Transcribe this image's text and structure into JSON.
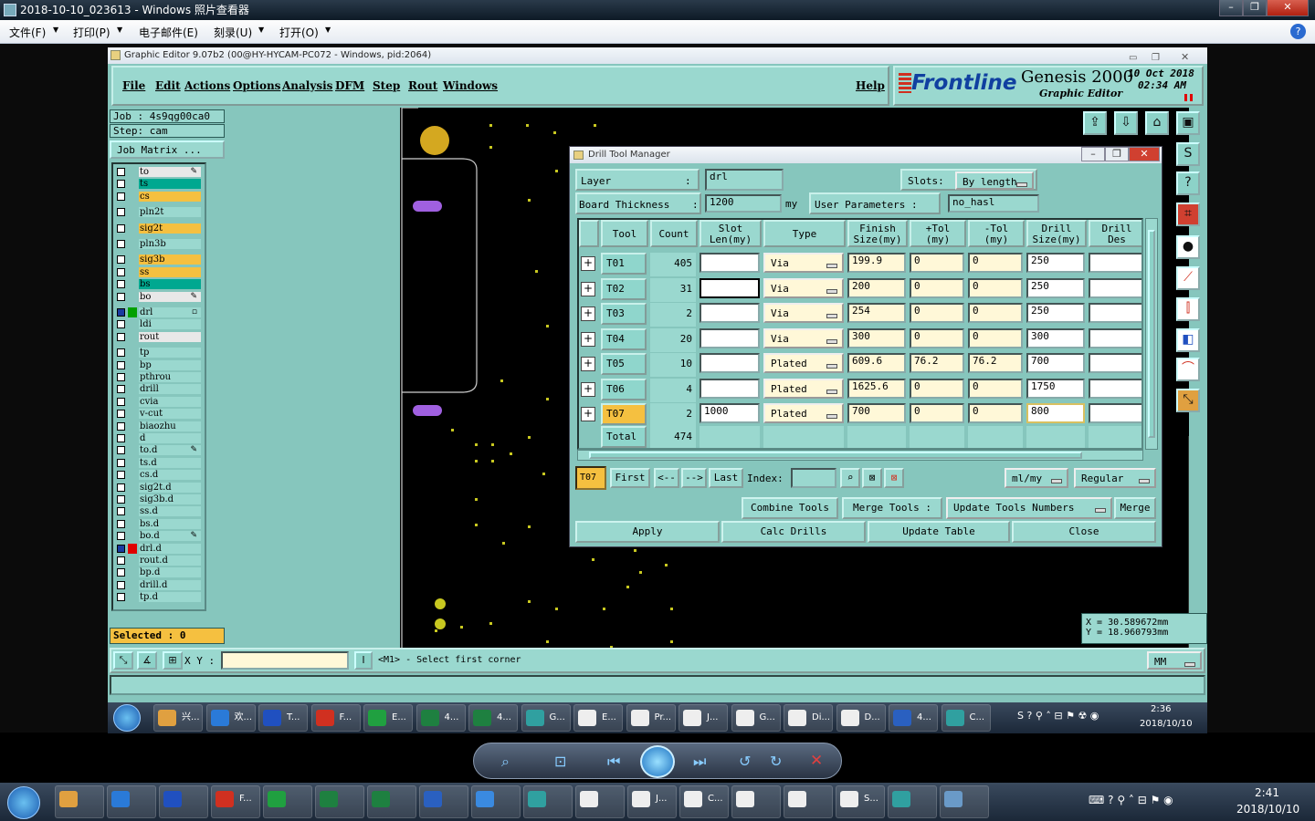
{
  "viewer": {
    "title": "2018-10-10_023613 - Windows 照片查看器",
    "menu": [
      "文件(F)",
      "打印(P)",
      "电子邮件(E)",
      "刻录(U)",
      "打开(O)"
    ]
  },
  "app": {
    "title": "Graphic Editor 9.07b2 (00@HY-HYCAM-PC072 - Windows, pid:2064)",
    "menu": [
      "File",
      "Edit",
      "Actions",
      "Options",
      "Analysis",
      "DFM",
      "Step",
      "Rout",
      "Windows"
    ],
    "help": "Help",
    "brand": "Frontline",
    "product": "Genesis 2000",
    "product_sub": "Graphic Editor",
    "date": "10 Oct 2018",
    "time": "02:34 AM",
    "job": "Job : 4s9qg00ca0",
    "step": "Step: cam",
    "job_matrix": "Job Matrix ...",
    "layers": [
      {
        "name": "to",
        "color": "#e8e8e8",
        "mark": "✎"
      },
      {
        "name": "ts",
        "color": "#00a890"
      },
      {
        "name": "cs",
        "color": "#f5c040"
      },
      {
        "name": "pln2t",
        "color": "#9ad8cf",
        "gap": true
      },
      {
        "name": "sig2t",
        "color": "#f5c040",
        "gap": true
      },
      {
        "name": "pln3b",
        "color": "#9ad8cf",
        "gap": true
      },
      {
        "name": "sig3b",
        "color": "#f5c040",
        "gap": true
      },
      {
        "name": "ss",
        "color": "#f5c040"
      },
      {
        "name": "bs",
        "color": "#00a890"
      },
      {
        "name": "bo",
        "color": "#e8e8e8",
        "mark": "✎"
      },
      {
        "name": "drl",
        "color": "#9ad8cf",
        "gap": true,
        "mark": "▫",
        "sel": "#00a000"
      },
      {
        "name": "ldi",
        "color": "#9ad8cf"
      },
      {
        "name": "rout",
        "color": "#e8e8e8"
      },
      {
        "name": "tp",
        "color": "#9ad8cf",
        "gap": true
      },
      {
        "name": "bp",
        "color": "#9ad8cf"
      },
      {
        "name": "pthrou",
        "color": "#9ad8cf"
      },
      {
        "name": "drill",
        "color": "#9ad8cf"
      },
      {
        "name": "cvia",
        "color": "#9ad8cf"
      },
      {
        "name": "v-cut",
        "color": "#9ad8cf"
      },
      {
        "name": "biaozhu",
        "color": "#9ad8cf"
      },
      {
        "name": "d",
        "color": "#9ad8cf"
      },
      {
        "name": "to.d",
        "color": "#9ad8cf",
        "mark": "✎"
      },
      {
        "name": "ts.d",
        "color": "#9ad8cf"
      },
      {
        "name": "cs.d",
        "color": "#9ad8cf"
      },
      {
        "name": "sig2t.d",
        "color": "#9ad8cf"
      },
      {
        "name": "sig3b.d",
        "color": "#9ad8cf"
      },
      {
        "name": "ss.d",
        "color": "#9ad8cf"
      },
      {
        "name": "bs.d",
        "color": "#9ad8cf"
      },
      {
        "name": "bo.d",
        "color": "#9ad8cf",
        "mark": "✎"
      },
      {
        "name": "drl.d",
        "color": "#9ad8cf",
        "sel": "#e00000"
      },
      {
        "name": "rout.d",
        "color": "#9ad8cf"
      },
      {
        "name": "bp.d",
        "color": "#9ad8cf"
      },
      {
        "name": "drill.d",
        "color": "#9ad8cf"
      },
      {
        "name": "tp.d",
        "color": "#9ad8cf"
      }
    ],
    "selected": "Selected : 0",
    "xy_label": "X Y :",
    "status_msg": "<M1> - Select first corner",
    "coord_x": "X = 30.589672mm",
    "coord_y": "Y = 18.960793mm",
    "units": "MM"
  },
  "drill": {
    "title": "Drill Tool Manager",
    "layer_label": "Layer",
    "layer_value": "drl",
    "slots_label": "Slots:",
    "slots_value": "By length",
    "thick_label": "Board Thickness",
    "thick_value": "1200",
    "thick_unit": "my",
    "user_params_label": "User Parameters :",
    "user_params_value": "no_hasl",
    "headers": [
      "Tool",
      "Count",
      "Slot\nLen(my)",
      "Type",
      "Finish\nSize(my)",
      "+Tol\n(my)",
      "-Tol\n(my)",
      "Drill\nSize(my)",
      "Drill\nDes"
    ],
    "rows": [
      {
        "tool": "T01",
        "count": "405",
        "slot": "",
        "type": "Via",
        "finish": "199.9",
        "ptol": "0",
        "ntol": "0",
        "drill": "250",
        "des": ""
      },
      {
        "tool": "T02",
        "count": "31",
        "slot": "",
        "type": "Via",
        "finish": "200",
        "ptol": "0",
        "ntol": "0",
        "drill": "250",
        "des": ""
      },
      {
        "tool": "T03",
        "count": "2",
        "slot": "",
        "type": "Via",
        "finish": "254",
        "ptol": "0",
        "ntol": "0",
        "drill": "250",
        "des": ""
      },
      {
        "tool": "T04",
        "count": "20",
        "slot": "",
        "type": "Via",
        "finish": "300",
        "ptol": "0",
        "ntol": "0",
        "drill": "300",
        "des": ""
      },
      {
        "tool": "T05",
        "count": "10",
        "slot": "",
        "type": "Plated",
        "finish": "609.6",
        "ptol": "76.2",
        "ntol": "76.2",
        "drill": "700",
        "des": ""
      },
      {
        "tool": "T06",
        "count": "4",
        "slot": "",
        "type": "Plated",
        "finish": "1625.6",
        "ptol": "0",
        "ntol": "0",
        "drill": "1750",
        "des": ""
      },
      {
        "tool": "T07",
        "count": "2",
        "slot": "1000",
        "type": "Plated",
        "finish": "700",
        "ptol": "0",
        "ntol": "0",
        "drill": "800",
        "des": ""
      }
    ],
    "total_label": "Total",
    "total_count": "474",
    "current_tool": "T07",
    "nav": {
      "first": "First",
      "prev": "<--",
      "next": "-->",
      "last": "Last",
      "index": "Index:"
    },
    "unit_opt": "ml/my",
    "mode_opt": "Regular",
    "combine": "Combine Tools",
    "merge_tools": "Merge Tools :",
    "update_numbers": "Update Tools Numbers",
    "merge": "Merge",
    "apply": "Apply",
    "calc": "Calc Drills",
    "update_table": "Update Table",
    "close": "Close"
  },
  "taskbar_inner": {
    "items": [
      {
        "label": "兴...",
        "color": "#e0a040"
      },
      {
        "label": "欢...",
        "color": "#2a7ad8"
      },
      {
        "label": "T...",
        "color": "#2050c0"
      },
      {
        "label": "F...",
        "color": "#d03020"
      },
      {
        "label": "E...",
        "color": "#20a040"
      },
      {
        "label": "4...",
        "color": "#1e8040"
      },
      {
        "label": "4...",
        "color": "#1e8040"
      },
      {
        "label": "G...",
        "color": "#30a0a0"
      },
      {
        "label": "E...",
        "color": "#eeeeee"
      },
      {
        "label": "Pr...",
        "color": "#eeeeee"
      },
      {
        "label": "J...",
        "color": "#eeeeee"
      },
      {
        "label": "G...",
        "color": "#eeeeee"
      },
      {
        "label": "Di...",
        "color": "#eeeeee"
      },
      {
        "label": "D...",
        "color": "#eeeeee"
      },
      {
        "label": "4...",
        "color": "#2a60c0"
      },
      {
        "label": "C...",
        "color": "#30a0a0"
      }
    ],
    "time": "2:36",
    "date": "2018/10/10"
  },
  "taskbar_outer": {
    "items": [
      {
        "label": "",
        "color": "#e0a040"
      },
      {
        "label": "",
        "color": "#2a7ad8"
      },
      {
        "label": "",
        "color": "#2050c0"
      },
      {
        "label": "F...",
        "color": "#d03020"
      },
      {
        "label": "",
        "color": "#20a040"
      },
      {
        "label": "",
        "color": "#1e8040"
      },
      {
        "label": "",
        "color": "#1e8040"
      },
      {
        "label": "",
        "color": "#2a60c0"
      },
      {
        "label": "",
        "color": "#3a8ae0"
      },
      {
        "label": "",
        "color": "#30a0a0"
      },
      {
        "label": "",
        "color": "#eeeeee"
      },
      {
        "label": "J...",
        "color": "#eeeeee"
      },
      {
        "label": "C...",
        "color": "#eeeeee"
      },
      {
        "label": "",
        "color": "#eeeeee"
      },
      {
        "label": "",
        "color": "#eeeeee"
      },
      {
        "label": "S...",
        "color": "#eeeeee"
      },
      {
        "label": "",
        "color": "#30a0a0"
      },
      {
        "label": "",
        "color": "#6a9ac8"
      }
    ],
    "time": "2:41",
    "date": "2018/10/10"
  }
}
